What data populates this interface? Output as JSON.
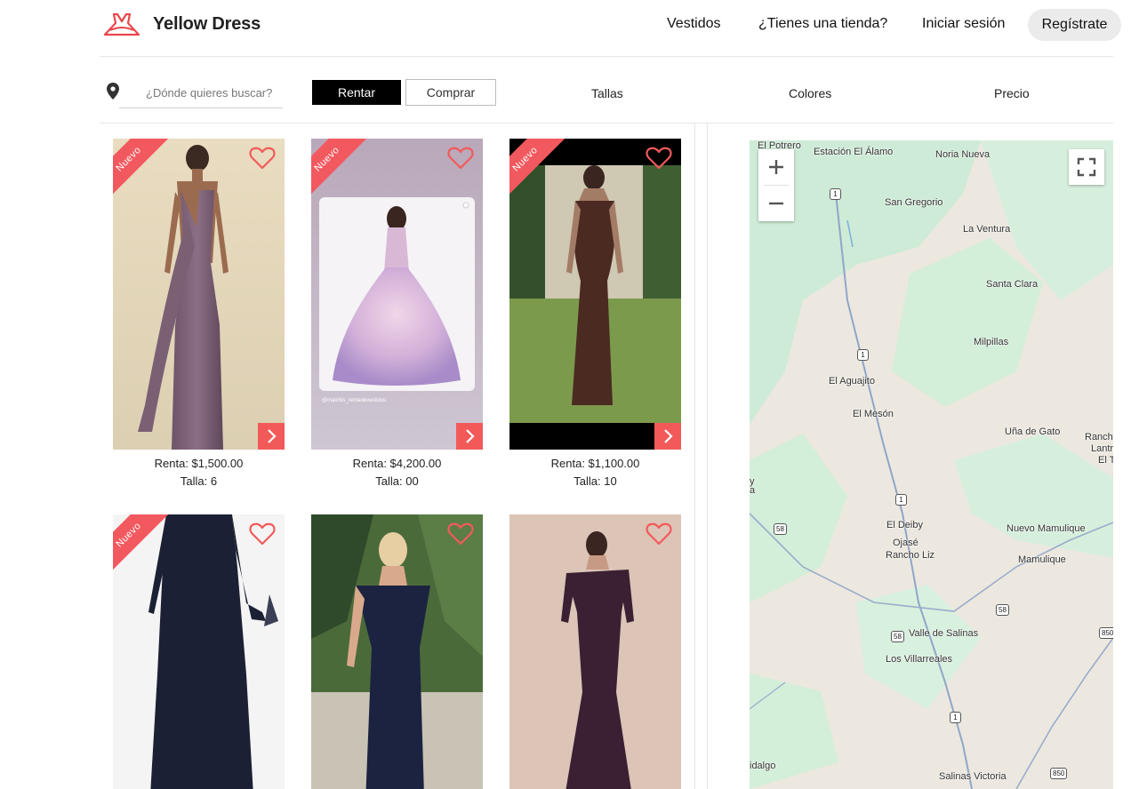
{
  "header": {
    "brand": "Yellow Dress",
    "nav": {
      "dresses": "Vestidos",
      "store": "¿Tienes una tienda?",
      "login": "Iniciar sesión",
      "register": "Regístrate"
    }
  },
  "filters": {
    "search_placeholder": "¿Dónde quieres buscar?",
    "rent": "Rentar",
    "buy": "Comprar",
    "sizes": "Tallas",
    "colors": "Colores",
    "price": "Precio"
  },
  "listings": [
    {
      "badge": "Nuevo",
      "price": "Renta: $1,500.00",
      "size": "Talla: 6"
    },
    {
      "badge": "Nuevo",
      "price": "Renta: $4,200.00",
      "size": "Talla: 00"
    },
    {
      "badge": "Nuevo",
      "price": "Renta: $1,100.00",
      "size": "Talla: 10"
    },
    {
      "badge": "Nuevo",
      "price": "",
      "size": ""
    },
    {
      "badge": "",
      "price": "",
      "size": ""
    },
    {
      "badge": "",
      "price": "",
      "size": ""
    }
  ],
  "photo_watermark": "@maichis_rentadevestidos",
  "map": {
    "places": [
      "El Potrero",
      "Estación El Álamo",
      "Noria Nueva",
      "San Gregorio",
      "La Ventura",
      "Santa Clara",
      "Milpillas",
      "El Aguajito",
      "El Mesón",
      "Uña de Gato",
      "Ranch",
      "Lantris",
      "El T",
      "El Deiby",
      "Ojasé",
      "Rancho Liz",
      "Nuevo Mamulique",
      "Mamulique",
      "Valle de Salinas",
      "Los Villarreales",
      "Salinas Victoria",
      "idalgo",
      "y",
      "a"
    ],
    "routes": [
      "1",
      "1",
      "1",
      "58",
      "58",
      "58",
      "1",
      "850",
      "850"
    ]
  },
  "colors": {
    "accent": "#f25a5a",
    "map_green": "#cdebd6",
    "map_land": "#ece8df"
  }
}
